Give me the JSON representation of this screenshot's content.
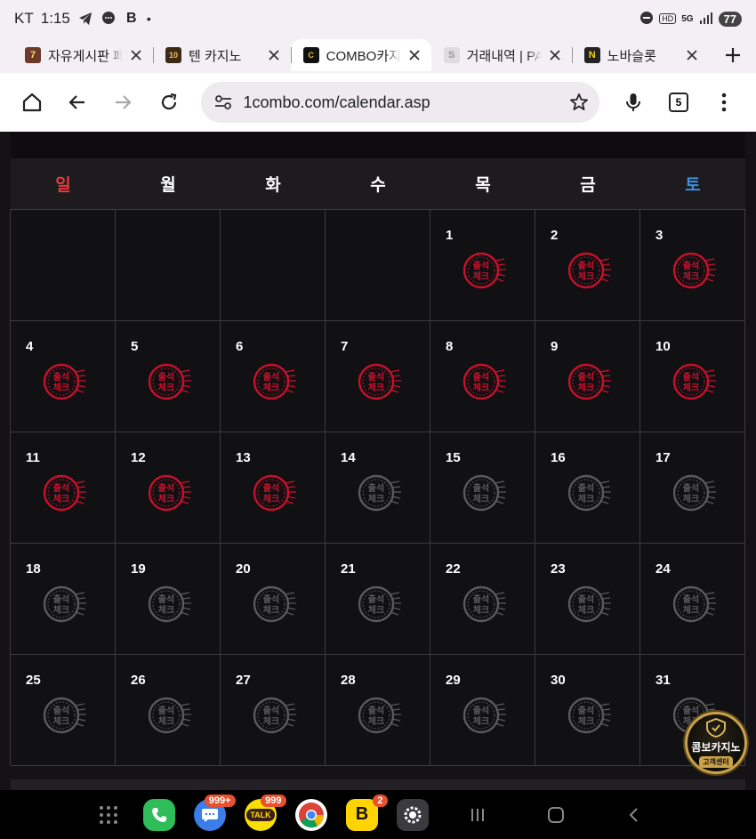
{
  "status": {
    "carrier": "KT",
    "time": "1:15",
    "battery": "77",
    "network": "5G"
  },
  "tabs": [
    {
      "title": "자유게시판 페이지",
      "favicon": "slot-icon",
      "active": false
    },
    {
      "title": "텐 카지노",
      "favicon": "ten-icon",
      "active": false
    },
    {
      "title": "COMBO카지노",
      "favicon": "combo-icon",
      "active": true
    },
    {
      "title": "거래내역 | PAYZ",
      "favicon": "s-icon",
      "active": false
    },
    {
      "title": "노바슬롯",
      "favicon": "n-icon",
      "active": false
    }
  ],
  "toolbar": {
    "url": "1combo.com/calendar.asp",
    "tab_count": "5"
  },
  "calendar": {
    "weekdays": [
      "일",
      "월",
      "화",
      "수",
      "목",
      "금",
      "토"
    ],
    "stamp_text_top": "출석",
    "stamp_text_bottom": "체크",
    "leading_blank_days": 4,
    "checked_days": [
      1,
      2,
      3,
      4,
      5,
      6,
      7,
      8,
      9,
      10,
      11,
      12,
      13
    ],
    "days_in_month": 31,
    "colors": {
      "checked": "#c8102e",
      "unchecked": "#5a5a5c",
      "sunday": "#e53b3b",
      "saturday": "#3d8ee0"
    }
  },
  "float_badge": {
    "title": "콤보카지노",
    "subtitle": "고객센터"
  },
  "dock": {
    "apps": [
      {
        "name": "phone-app",
        "badge": ""
      },
      {
        "name": "messages-app",
        "badge": "999+"
      },
      {
        "name": "kakaotalk-app",
        "badge": "999",
        "label": "TALK"
      },
      {
        "name": "chrome-app",
        "badge": ""
      },
      {
        "name": "b-app",
        "badge": "2"
      },
      {
        "name": "settings-app",
        "badge": ""
      }
    ]
  }
}
